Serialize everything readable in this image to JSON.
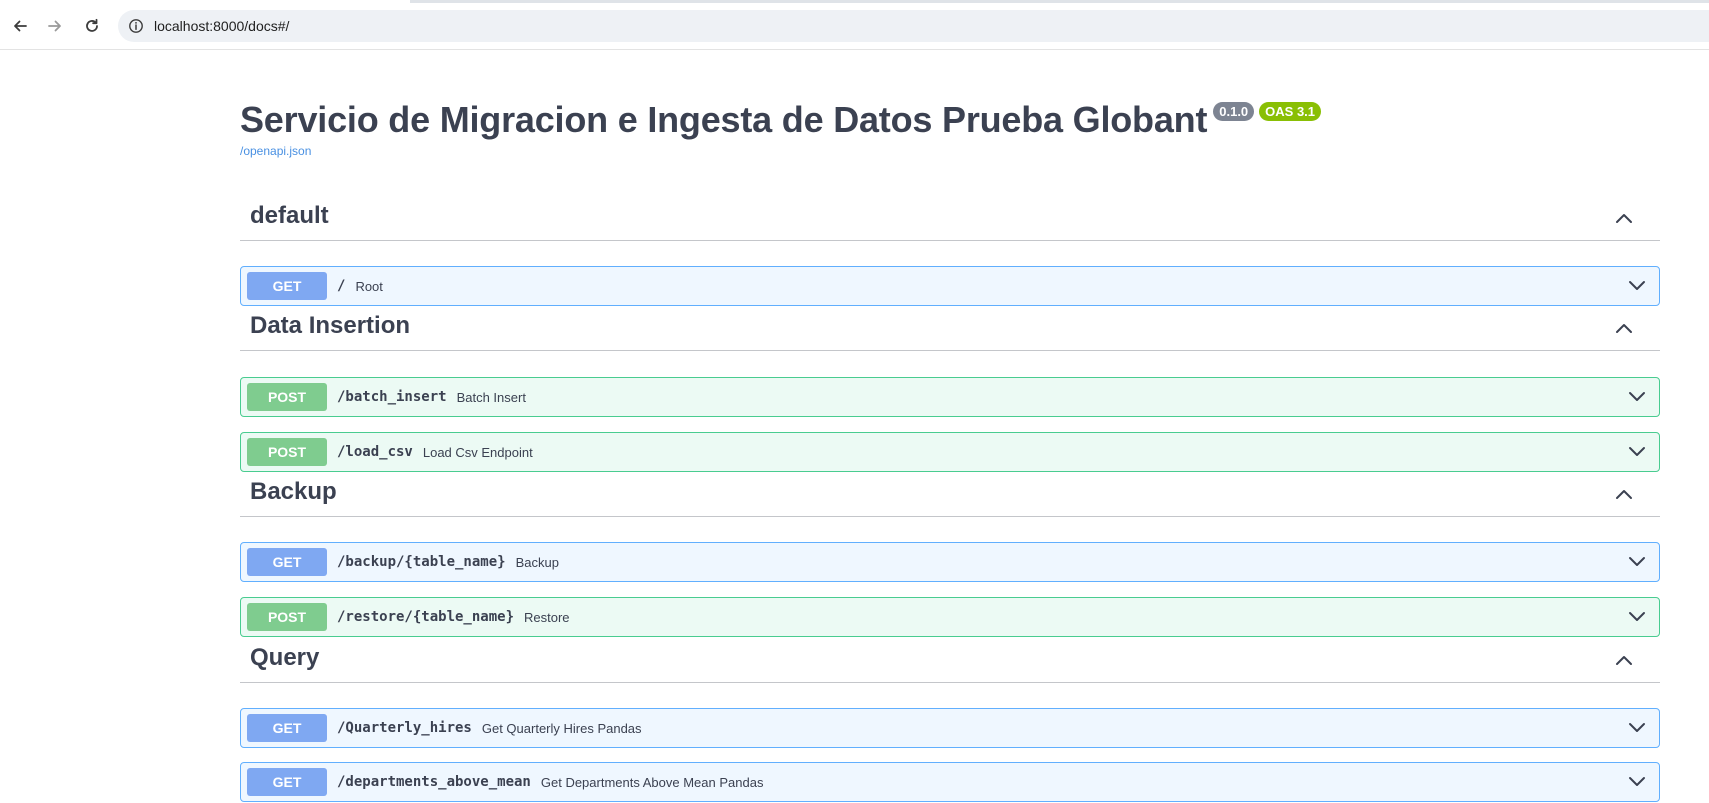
{
  "browser": {
    "url": "localhost:8000/docs#/"
  },
  "info": {
    "title": "Servicio de Migracion e Ingesta de Datos Prueba Globant",
    "version": "0.1.0",
    "oas": "OAS 3.1",
    "spec_link": "/openapi.json"
  },
  "tags": [
    {
      "name": "default",
      "operations": [
        {
          "method": "GET",
          "path": "/",
          "summary": "Root"
        }
      ]
    },
    {
      "name": "Data Insertion",
      "operations": [
        {
          "method": "POST",
          "path": "/batch_insert",
          "summary": "Batch Insert"
        },
        {
          "method": "POST",
          "path": "/load_csv",
          "summary": "Load Csv Endpoint"
        }
      ]
    },
    {
      "name": "Backup",
      "operations": [
        {
          "method": "GET",
          "path": "/backup/{table_name}",
          "summary": "Backup"
        },
        {
          "method": "POST",
          "path": "/restore/{table_name}",
          "summary": "Restore"
        }
      ]
    },
    {
      "name": "Query",
      "operations": [
        {
          "method": "GET",
          "path": "/Quarterly_hires",
          "summary": "Get Quarterly Hires Pandas"
        },
        {
          "method": "GET",
          "path": "/departments_above_mean",
          "summary": "Get Departments Above Mean Pandas"
        }
      ]
    }
  ],
  "colors": {
    "get": "#61affe",
    "post": "#49cc90",
    "version_badge": "#7d8492",
    "oas_badge": "#89bf04",
    "link": "#4990e2"
  },
  "icons": {
    "back": "arrow-left-icon",
    "forward": "arrow-right-icon",
    "reload": "reload-icon",
    "site_info": "info-icon",
    "collapse": "chevron-up-icon",
    "expand": "chevron-down-icon"
  }
}
